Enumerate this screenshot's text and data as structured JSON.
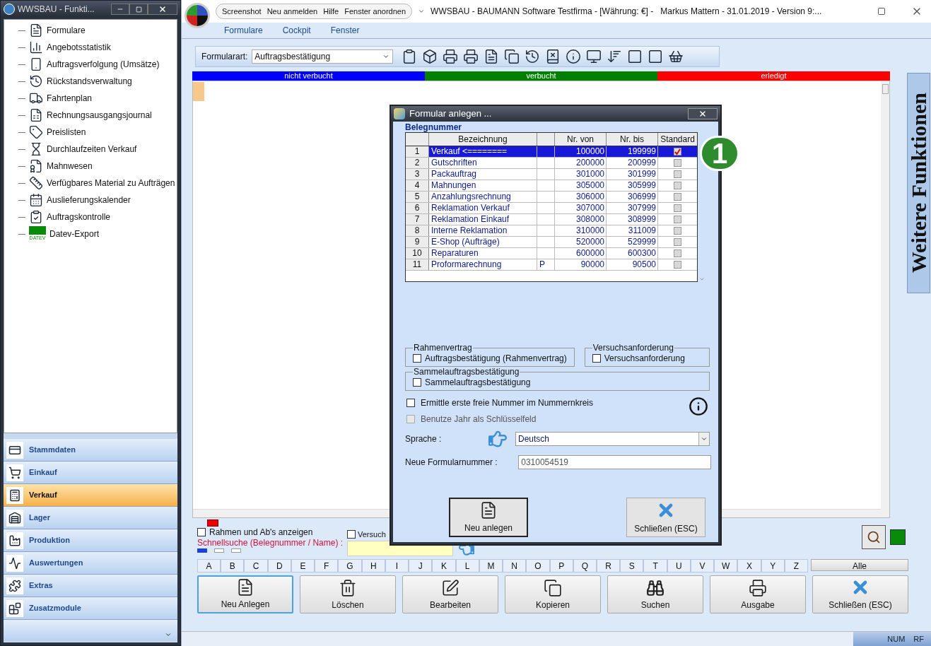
{
  "left_window": {
    "title": "WWSBAU - Funkti...",
    "tree": [
      {
        "label": "Formulare"
      },
      {
        "label": "Angebotsstatistik"
      },
      {
        "label": "Auftragsverfolgung (Umsätze)"
      },
      {
        "label": "Rückstandsverwaltung"
      },
      {
        "label": "Fahrtenplan"
      },
      {
        "label": "Rechnungsausgangsjournal"
      },
      {
        "label": "Preislisten"
      },
      {
        "label": "Durchlaufzeiten Verkauf"
      },
      {
        "label": "Mahnwesen"
      },
      {
        "label": "Verfügbares Material zu Aufträgen"
      },
      {
        "label": "Auslieferungskalender"
      },
      {
        "label": "Auftragskontrolle"
      },
      {
        "label": "Datev-Export",
        "logo_text": "DATEV"
      }
    ],
    "nav": [
      {
        "label": "Stammdaten",
        "selected": false
      },
      {
        "label": "Einkauf",
        "selected": false
      },
      {
        "label": "Verkauf",
        "selected": true
      },
      {
        "label": "Lager",
        "selected": false
      },
      {
        "label": "Produktion",
        "selected": false
      },
      {
        "label": "Auswertungen",
        "selected": false
      },
      {
        "label": "Extras",
        "selected": false
      },
      {
        "label": "Zusatzmodule",
        "selected": false
      }
    ]
  },
  "main_window": {
    "title": "WWSBAU - BAUMANN Software Testfirma - [Währung: €] -   Markus Mattern - 31.01.2019 - Version 9:...",
    "quick_access": [
      "Screenshot",
      "Neu anmelden",
      "Hilfe",
      "Fenster anordnen"
    ],
    "menu": [
      "Formulare",
      "Cockpit",
      "Fenster"
    ]
  },
  "toolbar": {
    "label": "Formularart:",
    "value": "Auftragsbestätigung"
  },
  "status_strips": [
    {
      "label": "nicht verbucht",
      "color": "#0000ff"
    },
    {
      "label": "verbucht",
      "color": "#008000"
    },
    {
      "label": "erledigt",
      "color": "#ff0000"
    }
  ],
  "side_tab": "Weitere Funktionen",
  "filters": {
    "checkboxes": [
      {
        "label": "Rahmen und Ab's anzeigen",
        "checked": false
      },
      {
        "label": "Versuch",
        "checked": false
      }
    ],
    "search_label": "Schnellsuche (Belegnummer / Name) :"
  },
  "letters": [
    "A",
    "B",
    "C",
    "D",
    "E",
    "F",
    "G",
    "H",
    "I",
    "J",
    "K",
    "L",
    "M",
    "N",
    "O",
    "P",
    "Q",
    "R",
    "S",
    "T",
    "U",
    "V",
    "W",
    "X",
    "Y",
    "Z"
  ],
  "all_label": "Alle",
  "actions": [
    {
      "label": "Neu Anlegen",
      "kind": "new",
      "focused": true
    },
    {
      "label": "Löschen",
      "kind": "delete",
      "focused": false
    },
    {
      "label": "Bearbeiten",
      "kind": "edit",
      "focused": false
    },
    {
      "label": "Kopieren",
      "kind": "copy",
      "focused": false
    },
    {
      "label": "Suchen",
      "kind": "search",
      "focused": false
    },
    {
      "label": "Ausgabe",
      "kind": "print",
      "focused": false
    },
    {
      "label": "Schließen (ESC)",
      "kind": "close",
      "focused": false
    }
  ],
  "status_bar": [
    "NUM",
    "RF"
  ],
  "badge": "1",
  "dialog": {
    "title": "Formular anlegen ...",
    "section": "Belegnummer",
    "columns": [
      "Bezeichnung",
      "Nr. von",
      "Nr. bis",
      "Standard"
    ],
    "rows": [
      {
        "no": "1",
        "name": "Verkauf <========",
        "from": "100000",
        "to": "199999",
        "standard": true,
        "selected": true
      },
      {
        "no": "2",
        "name": "Gutschriften",
        "from": "200000",
        "to": "200999",
        "standard": false,
        "selected": false
      },
      {
        "no": "3",
        "name": "Packauftrag",
        "from": "301000",
        "to": "301999",
        "standard": false,
        "selected": false
      },
      {
        "no": "4",
        "name": "Mahnungen",
        "from": "305000",
        "to": "305999",
        "standard": false,
        "selected": false
      },
      {
        "no": "5",
        "name": "Anzahlungsrechnung",
        "from": "306000",
        "to": "306999",
        "standard": false,
        "selected": false
      },
      {
        "no": "6",
        "name": "Reklamation Verkauf",
        "from": "307000",
        "to": "307999",
        "standard": false,
        "selected": false
      },
      {
        "no": "7",
        "name": "Reklamation Einkauf",
        "from": "308000",
        "to": "308999",
        "standard": false,
        "selected": false
      },
      {
        "no": "8",
        "name": "Interne Reklamation",
        "from": "310000",
        "to": "311009",
        "standard": false,
        "selected": false
      },
      {
        "no": "9",
        "name": "E-Shop (Aufträge)",
        "from": "520000",
        "to": "529999",
        "standard": false,
        "selected": false
      },
      {
        "no": "10",
        "name": "Reparaturen",
        "from": "600000",
        "to": "600300",
        "standard": false,
        "selected": false
      },
      {
        "no": "11",
        "name": "Proformarechnung",
        "flag": "P",
        "from": "90000",
        "to": "90500",
        "standard": false,
        "selected": false
      }
    ],
    "groups": [
      {
        "title": "Rahmenvertrag",
        "option": {
          "label": "Auftragsbestätigung (Rahmenvertrag)",
          "checked": false
        }
      },
      {
        "title": "Versuchsanforderung",
        "option": {
          "label": "Versuchsanforderung",
          "checked": false
        }
      },
      {
        "title": "Sammelauftragsbestätigung",
        "option": {
          "label": "Sammelauftragsbestätigung",
          "checked": false
        }
      }
    ],
    "options": [
      {
        "label": "Ermittle erste freie Nummer im Nummernkreis",
        "checked": false,
        "disabled": false
      },
      {
        "label": "Benutze Jahr als Schlüsselfeld",
        "checked": false,
        "disabled": true
      }
    ],
    "language": {
      "label": "Sprache :",
      "value": "Deutsch"
    },
    "number": {
      "label": "Neue Formularnummer :",
      "value": "0310054519"
    },
    "buttons": [
      {
        "label": "Neu anlegen",
        "kind": "new"
      },
      {
        "label": "Schließen (ESC)",
        "kind": "close"
      }
    ]
  }
}
